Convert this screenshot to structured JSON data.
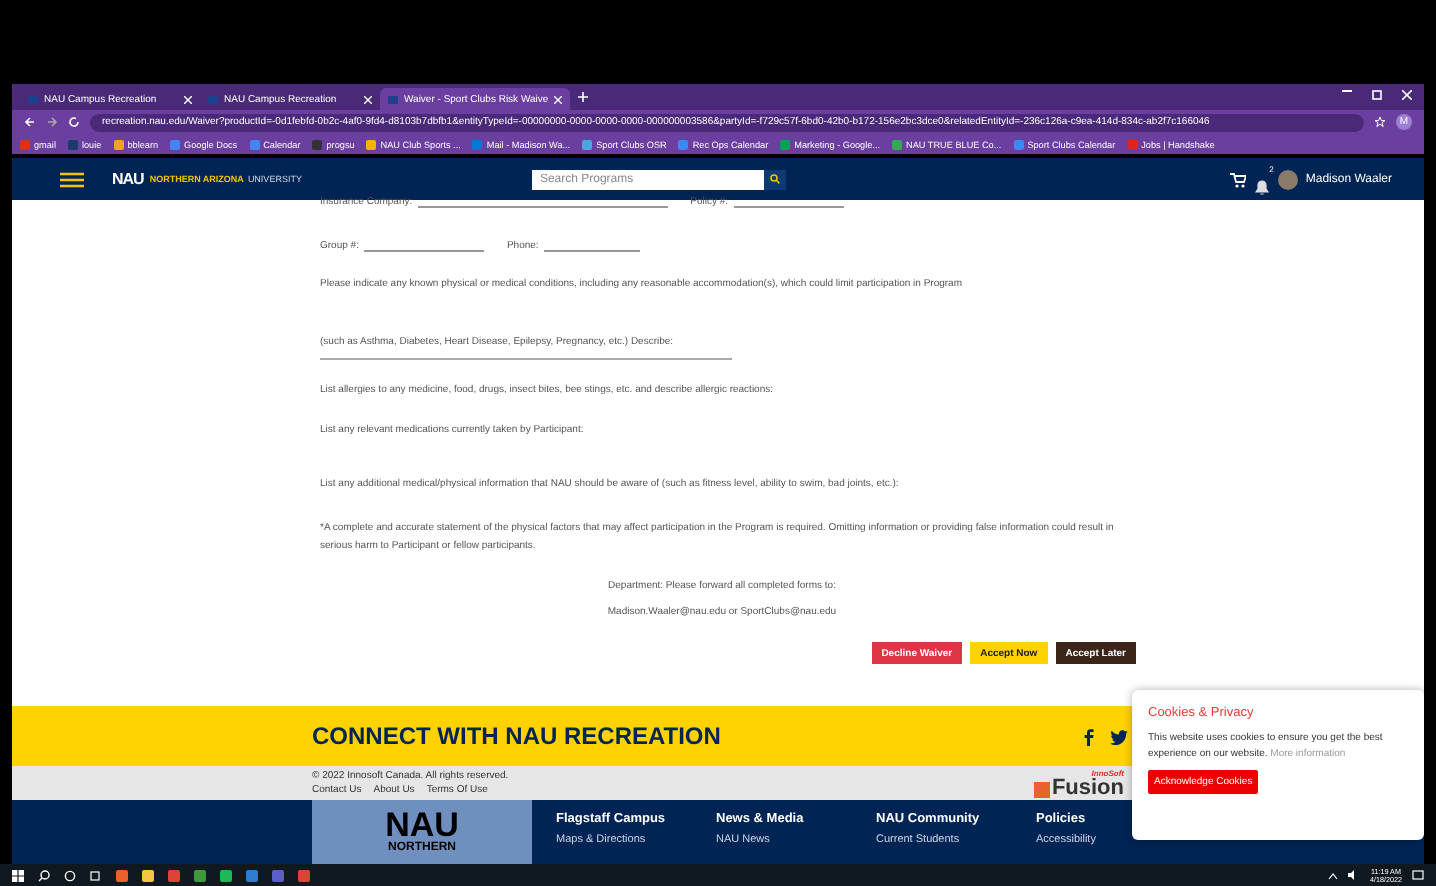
{
  "browser": {
    "tabs": [
      {
        "title": "NAU Campus Recreation",
        "selected": false
      },
      {
        "title": "NAU Campus Recreation",
        "selected": false
      },
      {
        "title": "Waiver - Sport Clubs Risk Waive",
        "selected": true
      }
    ],
    "url": "recreation.nau.edu/Waiver?productId=-0d1febfd-0b2c-4af0-9fd4-d8103b7dbfb1&entityTypeId=-00000000-0000-0000-0000-000000003586&partyId=-f729c57f-6bd0-42b0-b172-156e2bc3dce0&relatedEntityId=-236c126a-c9ea-414d-834c-ab2f7c166046",
    "profile": "M",
    "bookmarks": [
      {
        "label": "gmail",
        "color": "#d93025"
      },
      {
        "label": "louie",
        "color": "#1a3a6b"
      },
      {
        "label": "bblearn",
        "color": "#f4a020"
      },
      {
        "label": "Google Docs",
        "color": "#4285f4"
      },
      {
        "label": "Calendar",
        "color": "#4285f4"
      },
      {
        "label": "progsu",
        "color": "#333333"
      },
      {
        "label": "NAU Club Sports ...",
        "color": "#f4b400"
      },
      {
        "label": "Mail - Madison Wa...",
        "color": "#0078d4"
      },
      {
        "label": "Sport Clubs OSR",
        "color": "#4fa3e0"
      },
      {
        "label": "Rec Ops Calendar",
        "color": "#4285f4"
      },
      {
        "label": "Marketing - Google...",
        "color": "#0f9d58"
      },
      {
        "label": "NAU TRUE BLUE Co...",
        "color": "#34a853"
      },
      {
        "label": "Sport Clubs Calendar",
        "color": "#4285f4"
      },
      {
        "label": "Jobs | Handshake",
        "color": "#e2231a"
      }
    ]
  },
  "navbar": {
    "logo": "NAU",
    "logo_subtitle": "NORTHERN ARIZONA",
    "logo_subtitle_2": "UNIVERSITY",
    "search": {
      "placeholder": "Search Programs"
    },
    "notifications": "2",
    "user": "Madison Waaler"
  },
  "form": {
    "rows": [
      {
        "kind": "fields",
        "parts": [
          "Insurance Company:",
          "Policy #:"
        ]
      },
      {
        "kind": "fields",
        "parts": [
          "Group #:",
          "Phone:"
        ]
      },
      {
        "kind": "text",
        "text": "Please indicate any known physical or medical conditions, including any reasonable accommodation(s), which could limit participation in Program"
      },
      {
        "kind": "line",
        "text": "(such as Asthma, Diabetes, Heart Disease, Epilepsy, Pregnancy, etc.) Describe:"
      },
      {
        "kind": "text",
        "text": "List allergies to any medicine, food, drugs, insect bites, bee stings, etc. and describe allergic reactions:"
      },
      {
        "kind": "text",
        "text": "List any relevant medications currently taken by Participant:"
      },
      {
        "kind": "text",
        "text": "List any additional medical/physical information that NAU should be aware of (such as fitness level, ability to swim, bad joints, etc.):"
      },
      {
        "kind": "text",
        "text": "*A complete and accurate statement of the physical factors that may affect participation in the Program is required. Omitting information or providing false information could result in serious harm to Participant or fellow participants."
      },
      {
        "kind": "center",
        "text": "Department: Please forward all completed forms to:"
      },
      {
        "kind": "center",
        "text": "Madison.Waaler@nau.edu or SportClubs@nau.edu"
      }
    ],
    "buttons": [
      {
        "label": "Decline Waiver",
        "kind": "decline"
      },
      {
        "label": "Accept Now",
        "kind": "accept"
      },
      {
        "label": "Accept Later",
        "kind": "later"
      }
    ]
  },
  "connect": {
    "title": "CONNECT WITH NAU RECREATION"
  },
  "copyright": {
    "text": "© 2022 Innosoft Canada. All rights reserved.",
    "links": [
      "Contact Us",
      "About Us",
      "Terms Of Use"
    ],
    "brand_top": "InnoSoft",
    "brand": "Fusion"
  },
  "footer": {
    "logo": "NAU",
    "logo_sub": "NORTHERN",
    "columns": [
      {
        "title": "Flagstaff Campus",
        "link": "Maps & Directions"
      },
      {
        "title": "News & Media",
        "link": "NAU News"
      },
      {
        "title": "NAU Community",
        "link": "Current Students"
      },
      {
        "title": "Policies",
        "link": "Accessibility"
      }
    ]
  },
  "cookie": {
    "title": "Cookies & Privacy",
    "text": "This website uses cookies to ensure you get the best experience on our website.",
    "link": "More information",
    "button": "Acknowledge Cookies"
  },
  "taskbar": {
    "time": "11:19 AM",
    "date": "4/18/2022"
  }
}
